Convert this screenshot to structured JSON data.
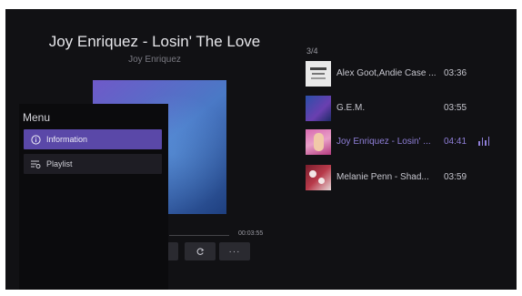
{
  "now_playing": {
    "title": "Joy Enriquez - Losin' The Love",
    "artist": "Joy Enriquez",
    "total_time": "00:03:55"
  },
  "controls": {
    "prev_icon": "previous-icon",
    "repeat_icon": "repeat-icon",
    "more_label": "···"
  },
  "menu": {
    "title": "Menu",
    "items": [
      {
        "label": "Information",
        "icon": "info-icon",
        "selected": true
      },
      {
        "label": "Playlist",
        "icon": "playlist-icon",
        "selected": false
      }
    ]
  },
  "playlist": {
    "counter": "3/4",
    "tracks": [
      {
        "name": "Alex Goot,Andie Case ...",
        "duration": "03:36",
        "current": false
      },
      {
        "name": "G.E.M.",
        "duration": "03:55",
        "current": false
      },
      {
        "name": "Joy Enriquez - Losin' ...",
        "duration": "04:41",
        "current": true
      },
      {
        "name": "Melanie Penn - Shad...",
        "duration": "03:59",
        "current": false
      }
    ]
  },
  "colors": {
    "background": "#111114",
    "accent": "#5a48a8",
    "current_track_text": "#8f7fd8"
  }
}
